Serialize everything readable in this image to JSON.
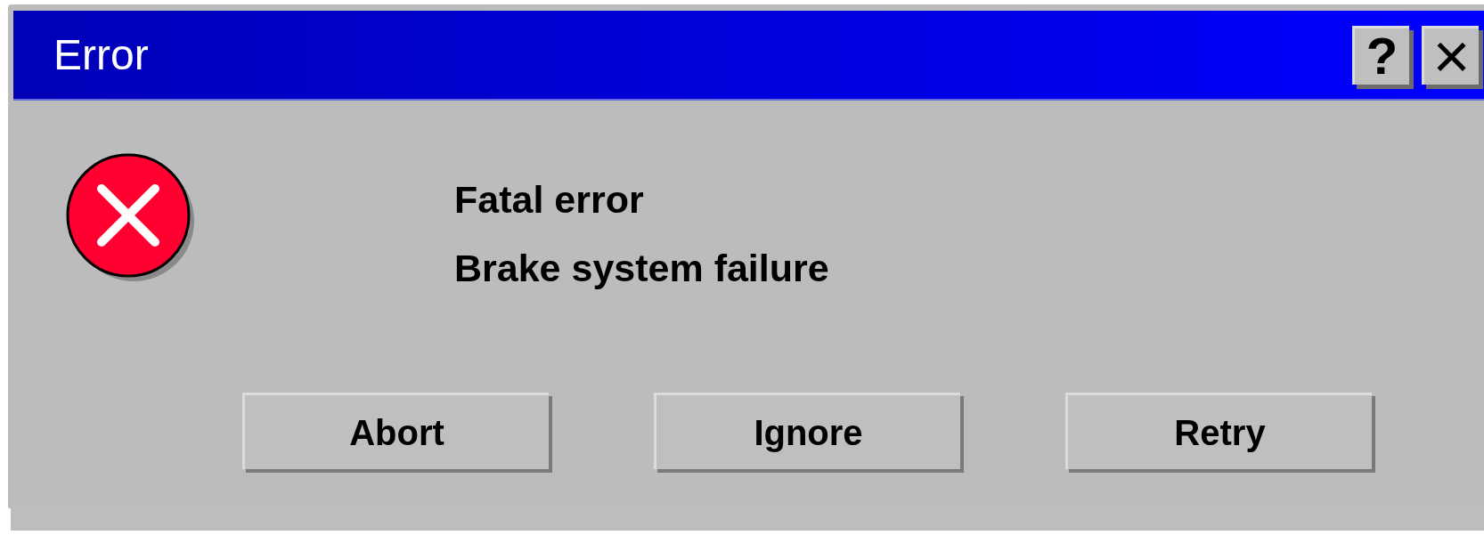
{
  "window": {
    "title": "Error",
    "title_buttons": [
      {
        "kind": "help",
        "label": "?"
      },
      {
        "kind": "close",
        "label": "×"
      }
    ]
  },
  "message": {
    "lines": [
      "Fatal error",
      "Brake system failure"
    ]
  },
  "buttons": [
    "Abort",
    "Ignore",
    "Retry"
  ]
}
